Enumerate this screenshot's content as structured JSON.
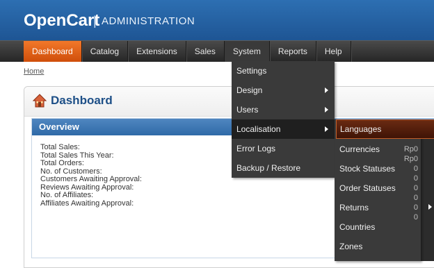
{
  "header": {
    "brand": "OpenCart",
    "separator": "|",
    "subtitle": "ADMINISTRATION"
  },
  "menu": {
    "items": [
      {
        "label": "Dashboard"
      },
      {
        "label": "Catalog"
      },
      {
        "label": "Extensions"
      },
      {
        "label": "Sales"
      },
      {
        "label": "System"
      },
      {
        "label": "Reports"
      },
      {
        "label": "Help"
      }
    ]
  },
  "breadcrumb": {
    "home": "Home"
  },
  "box": {
    "title": "Dashboard"
  },
  "overview": {
    "title": "Overview",
    "stats": [
      "Total Sales:",
      "Total Sales This Year:",
      "Total Orders:",
      "No. of Customers:",
      "Customers Awaiting Approval:",
      "Reviews Awaiting Approval:",
      "No. of Affiliates:",
      "Affiliates Awaiting Approval:"
    ],
    "values": [
      "Rp0",
      "Rp0",
      "0",
      "0",
      "0",
      "0",
      "0",
      "0"
    ]
  },
  "system_dropdown": {
    "items": [
      {
        "label": "Settings"
      },
      {
        "label": "Design"
      },
      {
        "label": "Users"
      },
      {
        "label": "Localisation"
      },
      {
        "label": "Error Logs"
      },
      {
        "label": "Backup / Restore"
      }
    ]
  },
  "localisation_submenu": {
    "items": [
      {
        "label": "Languages"
      },
      {
        "label": "Currencies"
      },
      {
        "label": "Stock Statuses"
      },
      {
        "label": "Order Statuses"
      },
      {
        "label": "Returns"
      },
      {
        "label": "Countries"
      },
      {
        "label": "Zones"
      }
    ]
  },
  "colors": {
    "header_blue": "#2d6fb2",
    "menu_dark": "#262626",
    "menu_active_orange": "#f2782a",
    "submenu_highlight": "#6a2a12",
    "title_blue": "#1d4f87"
  }
}
